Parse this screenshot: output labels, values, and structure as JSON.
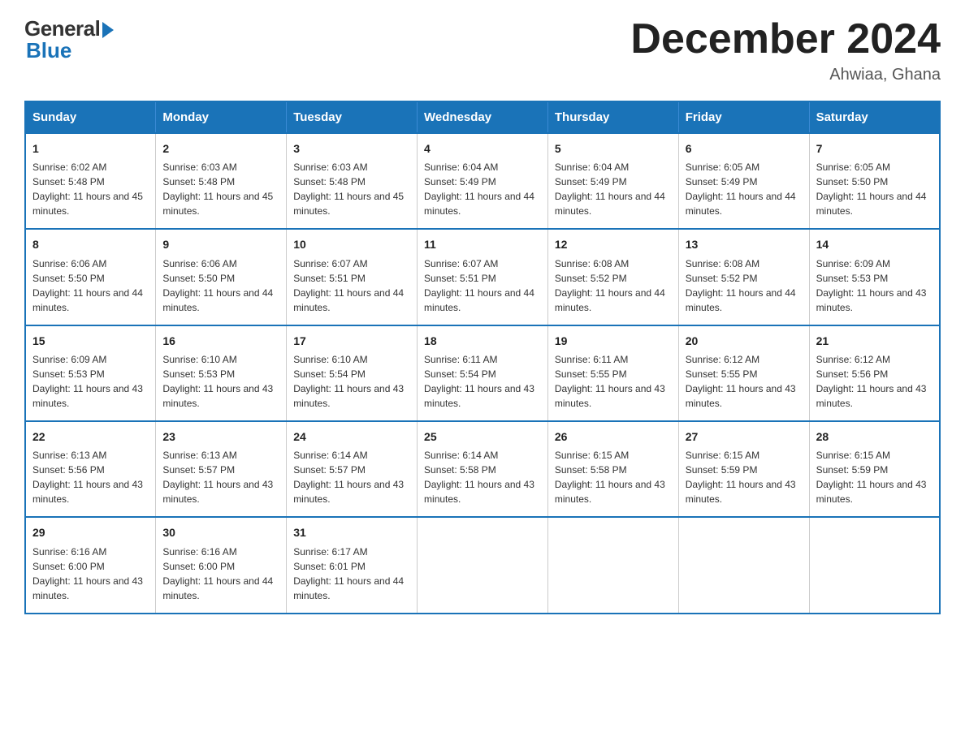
{
  "logo": {
    "general": "General",
    "blue": "Blue"
  },
  "title": {
    "month": "December 2024",
    "location": "Ahwiaa, Ghana"
  },
  "weekdays": [
    "Sunday",
    "Monday",
    "Tuesday",
    "Wednesday",
    "Thursday",
    "Friday",
    "Saturday"
  ],
  "weeks": [
    [
      {
        "day": "1",
        "sunrise": "Sunrise: 6:02 AM",
        "sunset": "Sunset: 5:48 PM",
        "daylight": "Daylight: 11 hours and 45 minutes."
      },
      {
        "day": "2",
        "sunrise": "Sunrise: 6:03 AM",
        "sunset": "Sunset: 5:48 PM",
        "daylight": "Daylight: 11 hours and 45 minutes."
      },
      {
        "day": "3",
        "sunrise": "Sunrise: 6:03 AM",
        "sunset": "Sunset: 5:48 PM",
        "daylight": "Daylight: 11 hours and 45 minutes."
      },
      {
        "day": "4",
        "sunrise": "Sunrise: 6:04 AM",
        "sunset": "Sunset: 5:49 PM",
        "daylight": "Daylight: 11 hours and 44 minutes."
      },
      {
        "day": "5",
        "sunrise": "Sunrise: 6:04 AM",
        "sunset": "Sunset: 5:49 PM",
        "daylight": "Daylight: 11 hours and 44 minutes."
      },
      {
        "day": "6",
        "sunrise": "Sunrise: 6:05 AM",
        "sunset": "Sunset: 5:49 PM",
        "daylight": "Daylight: 11 hours and 44 minutes."
      },
      {
        "day": "7",
        "sunrise": "Sunrise: 6:05 AM",
        "sunset": "Sunset: 5:50 PM",
        "daylight": "Daylight: 11 hours and 44 minutes."
      }
    ],
    [
      {
        "day": "8",
        "sunrise": "Sunrise: 6:06 AM",
        "sunset": "Sunset: 5:50 PM",
        "daylight": "Daylight: 11 hours and 44 minutes."
      },
      {
        "day": "9",
        "sunrise": "Sunrise: 6:06 AM",
        "sunset": "Sunset: 5:50 PM",
        "daylight": "Daylight: 11 hours and 44 minutes."
      },
      {
        "day": "10",
        "sunrise": "Sunrise: 6:07 AM",
        "sunset": "Sunset: 5:51 PM",
        "daylight": "Daylight: 11 hours and 44 minutes."
      },
      {
        "day": "11",
        "sunrise": "Sunrise: 6:07 AM",
        "sunset": "Sunset: 5:51 PM",
        "daylight": "Daylight: 11 hours and 44 minutes."
      },
      {
        "day": "12",
        "sunrise": "Sunrise: 6:08 AM",
        "sunset": "Sunset: 5:52 PM",
        "daylight": "Daylight: 11 hours and 44 minutes."
      },
      {
        "day": "13",
        "sunrise": "Sunrise: 6:08 AM",
        "sunset": "Sunset: 5:52 PM",
        "daylight": "Daylight: 11 hours and 44 minutes."
      },
      {
        "day": "14",
        "sunrise": "Sunrise: 6:09 AM",
        "sunset": "Sunset: 5:53 PM",
        "daylight": "Daylight: 11 hours and 43 minutes."
      }
    ],
    [
      {
        "day": "15",
        "sunrise": "Sunrise: 6:09 AM",
        "sunset": "Sunset: 5:53 PM",
        "daylight": "Daylight: 11 hours and 43 minutes."
      },
      {
        "day": "16",
        "sunrise": "Sunrise: 6:10 AM",
        "sunset": "Sunset: 5:53 PM",
        "daylight": "Daylight: 11 hours and 43 minutes."
      },
      {
        "day": "17",
        "sunrise": "Sunrise: 6:10 AM",
        "sunset": "Sunset: 5:54 PM",
        "daylight": "Daylight: 11 hours and 43 minutes."
      },
      {
        "day": "18",
        "sunrise": "Sunrise: 6:11 AM",
        "sunset": "Sunset: 5:54 PM",
        "daylight": "Daylight: 11 hours and 43 minutes."
      },
      {
        "day": "19",
        "sunrise": "Sunrise: 6:11 AM",
        "sunset": "Sunset: 5:55 PM",
        "daylight": "Daylight: 11 hours and 43 minutes."
      },
      {
        "day": "20",
        "sunrise": "Sunrise: 6:12 AM",
        "sunset": "Sunset: 5:55 PM",
        "daylight": "Daylight: 11 hours and 43 minutes."
      },
      {
        "day": "21",
        "sunrise": "Sunrise: 6:12 AM",
        "sunset": "Sunset: 5:56 PM",
        "daylight": "Daylight: 11 hours and 43 minutes."
      }
    ],
    [
      {
        "day": "22",
        "sunrise": "Sunrise: 6:13 AM",
        "sunset": "Sunset: 5:56 PM",
        "daylight": "Daylight: 11 hours and 43 minutes."
      },
      {
        "day": "23",
        "sunrise": "Sunrise: 6:13 AM",
        "sunset": "Sunset: 5:57 PM",
        "daylight": "Daylight: 11 hours and 43 minutes."
      },
      {
        "day": "24",
        "sunrise": "Sunrise: 6:14 AM",
        "sunset": "Sunset: 5:57 PM",
        "daylight": "Daylight: 11 hours and 43 minutes."
      },
      {
        "day": "25",
        "sunrise": "Sunrise: 6:14 AM",
        "sunset": "Sunset: 5:58 PM",
        "daylight": "Daylight: 11 hours and 43 minutes."
      },
      {
        "day": "26",
        "sunrise": "Sunrise: 6:15 AM",
        "sunset": "Sunset: 5:58 PM",
        "daylight": "Daylight: 11 hours and 43 minutes."
      },
      {
        "day": "27",
        "sunrise": "Sunrise: 6:15 AM",
        "sunset": "Sunset: 5:59 PM",
        "daylight": "Daylight: 11 hours and 43 minutes."
      },
      {
        "day": "28",
        "sunrise": "Sunrise: 6:15 AM",
        "sunset": "Sunset: 5:59 PM",
        "daylight": "Daylight: 11 hours and 43 minutes."
      }
    ],
    [
      {
        "day": "29",
        "sunrise": "Sunrise: 6:16 AM",
        "sunset": "Sunset: 6:00 PM",
        "daylight": "Daylight: 11 hours and 43 minutes."
      },
      {
        "day": "30",
        "sunrise": "Sunrise: 6:16 AM",
        "sunset": "Sunset: 6:00 PM",
        "daylight": "Daylight: 11 hours and 44 minutes."
      },
      {
        "day": "31",
        "sunrise": "Sunrise: 6:17 AM",
        "sunset": "Sunset: 6:01 PM",
        "daylight": "Daylight: 11 hours and 44 minutes."
      },
      null,
      null,
      null,
      null
    ]
  ]
}
